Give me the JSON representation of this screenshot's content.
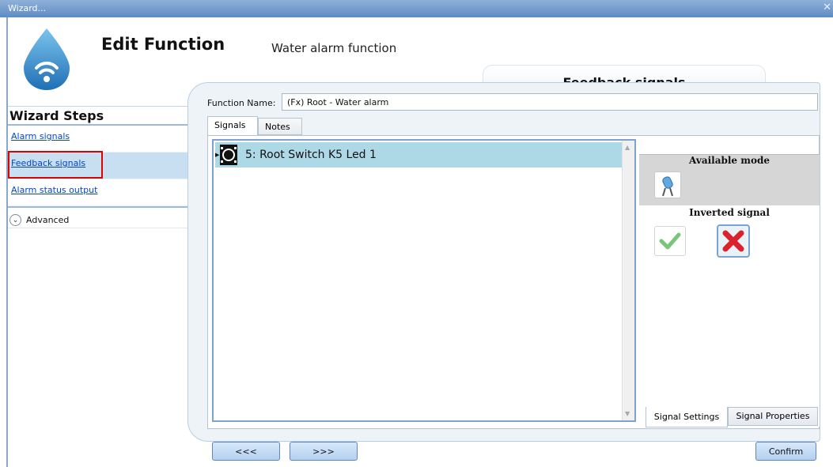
{
  "window": {
    "title": "Wizard...",
    "close_glyph": "✕"
  },
  "header": {
    "title": "Edit Function",
    "subtitle": "Water alarm function",
    "step_banner": "Feedback signals",
    "icon": "water-drop-wifi-icon"
  },
  "sidebar": {
    "title": "Wizard Steps",
    "items": [
      {
        "label": "Alarm signals",
        "active": false
      },
      {
        "label": "Feedback signals",
        "active": true
      },
      {
        "label": "Alarm status output",
        "active": false
      }
    ],
    "advanced_label": "Advanced"
  },
  "form": {
    "function_name_label": "Function Name:",
    "function_name_value": "(Fx) Root - Water alarm"
  },
  "tabs": {
    "signals": "Signals",
    "notes": "Notes"
  },
  "signals_list": {
    "items": [
      {
        "label": "5: Root Switch K5 Led 1",
        "icon": "switch-led-icon"
      }
    ]
  },
  "right_panel": {
    "available_mode_title": "Available mode",
    "mode_icon": "capacitor-icon",
    "inverted_signal_title": "Inverted signal",
    "inverted_yes_icon": "check-icon",
    "inverted_no_icon": "red-x-icon",
    "tabs": {
      "settings": "Signal Settings",
      "properties": "Signal Properties"
    }
  },
  "buttons": {
    "prev": "<<<",
    "next": ">>>",
    "confirm": "Confirm"
  },
  "colors": {
    "accent_highlight": "#e00000",
    "selected_row": "#add8e6",
    "titlebar": "#5f8bc4"
  }
}
